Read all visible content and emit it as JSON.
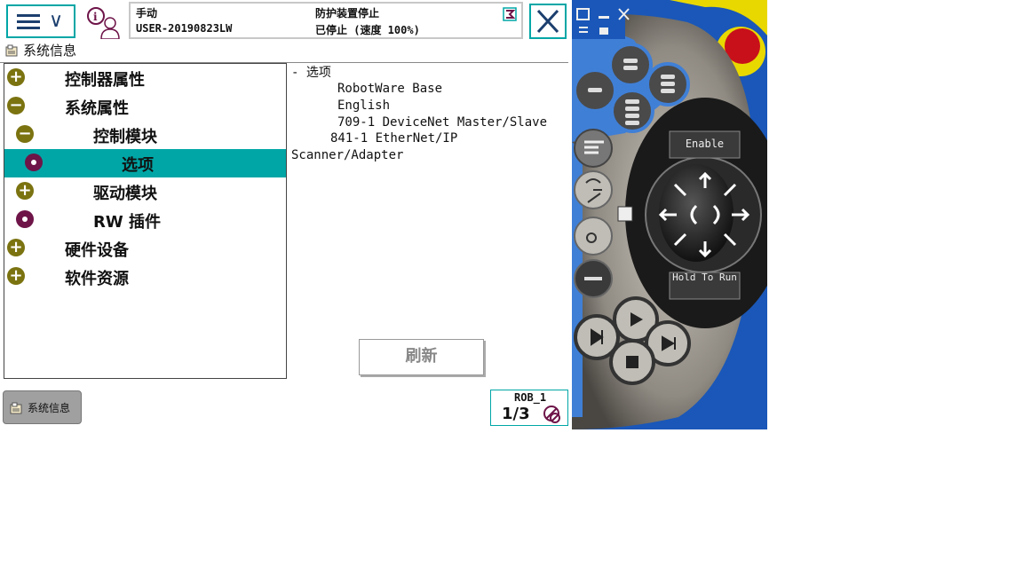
{
  "header": {
    "mode": "手动",
    "user": "USER-20190823LW",
    "guard_status": "防护装置停止",
    "run_status": "已停止 (速度 100%)"
  },
  "window": {
    "title": "系统信息"
  },
  "tree": {
    "items": [
      {
        "label": "控制器属性",
        "node": "expand"
      },
      {
        "label": "系统属性",
        "node": "collapse"
      },
      {
        "label": "控制模块",
        "node": "collapse"
      },
      {
        "label": "选项",
        "node": "leaf",
        "selected": true
      },
      {
        "label": "驱动模块",
        "node": "expand"
      },
      {
        "label": "RW 插件",
        "node": "leaf"
      },
      {
        "label": "硬件设备",
        "node": "expand"
      },
      {
        "label": "软件资源",
        "node": "expand"
      }
    ]
  },
  "detail": {
    "heading": "- 选项",
    "lines": [
      "RobotWare Base",
      "English",
      "709-1 DeviceNet Master/Slave",
      "841-1 EtherNet/IP",
      "Scanner/Adapter"
    ]
  },
  "buttons": {
    "refresh": "刷新"
  },
  "taskbar": {
    "item": "系统信息"
  },
  "robot": {
    "name": "ROB_1",
    "fraction": "1/3"
  },
  "pendant": {
    "enable": "Enable",
    "hold_to_run": "Hold To Run"
  },
  "colors": {
    "accent": "#00a6a6",
    "olive": "#7b7310",
    "purple": "#6e1448",
    "pendant_blue": "#1a57b8"
  }
}
